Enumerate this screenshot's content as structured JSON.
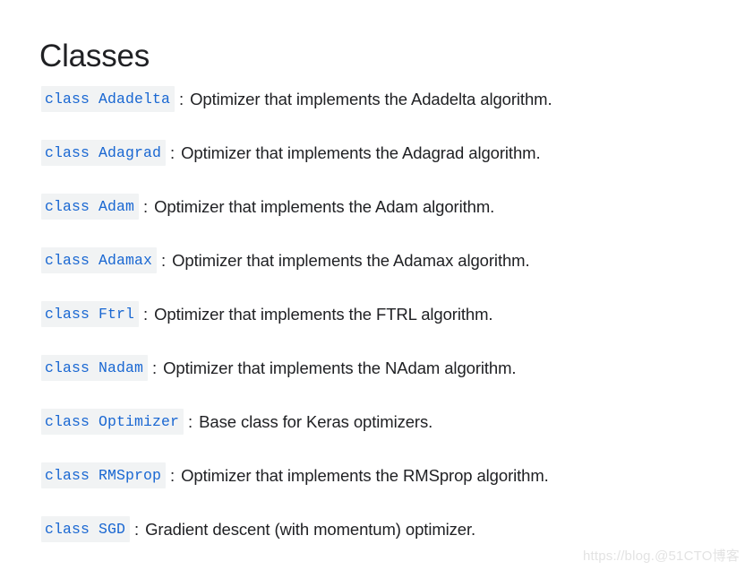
{
  "page": {
    "title": "Classes",
    "background_color": "#ffffff",
    "text_color": "#202124",
    "code_color": "#1967d2",
    "code_background": "#f1f3f4"
  },
  "classes": [
    {
      "keyword": "class",
      "name": "Adadelta",
      "separator": ":",
      "description": "Optimizer that implements the Adadelta algorithm."
    },
    {
      "keyword": "class",
      "name": "Adagrad",
      "separator": ":",
      "description": "Optimizer that implements the Adagrad algorithm."
    },
    {
      "keyword": "class",
      "name": "Adam",
      "separator": ":",
      "description": "Optimizer that implements the Adam algorithm."
    },
    {
      "keyword": "class",
      "name": "Adamax",
      "separator": ":",
      "description": "Optimizer that implements the Adamax algorithm."
    },
    {
      "keyword": "class",
      "name": "Ftrl",
      "separator": ":",
      "description": "Optimizer that implements the FTRL algorithm."
    },
    {
      "keyword": "class",
      "name": "Nadam",
      "separator": ":",
      "description": "Optimizer that implements the NAdam algorithm."
    },
    {
      "keyword": "class",
      "name": "Optimizer",
      "separator": ":",
      "description": "Base class for Keras optimizers."
    },
    {
      "keyword": "class",
      "name": "RMSprop",
      "separator": ":",
      "description": "Optimizer that implements the RMSprop algorithm."
    },
    {
      "keyword": "class",
      "name": "SGD",
      "separator": ":",
      "description": "Gradient descent (with momentum) optimizer."
    }
  ],
  "watermark": {
    "text": "https://blog.@51CTO博客"
  }
}
